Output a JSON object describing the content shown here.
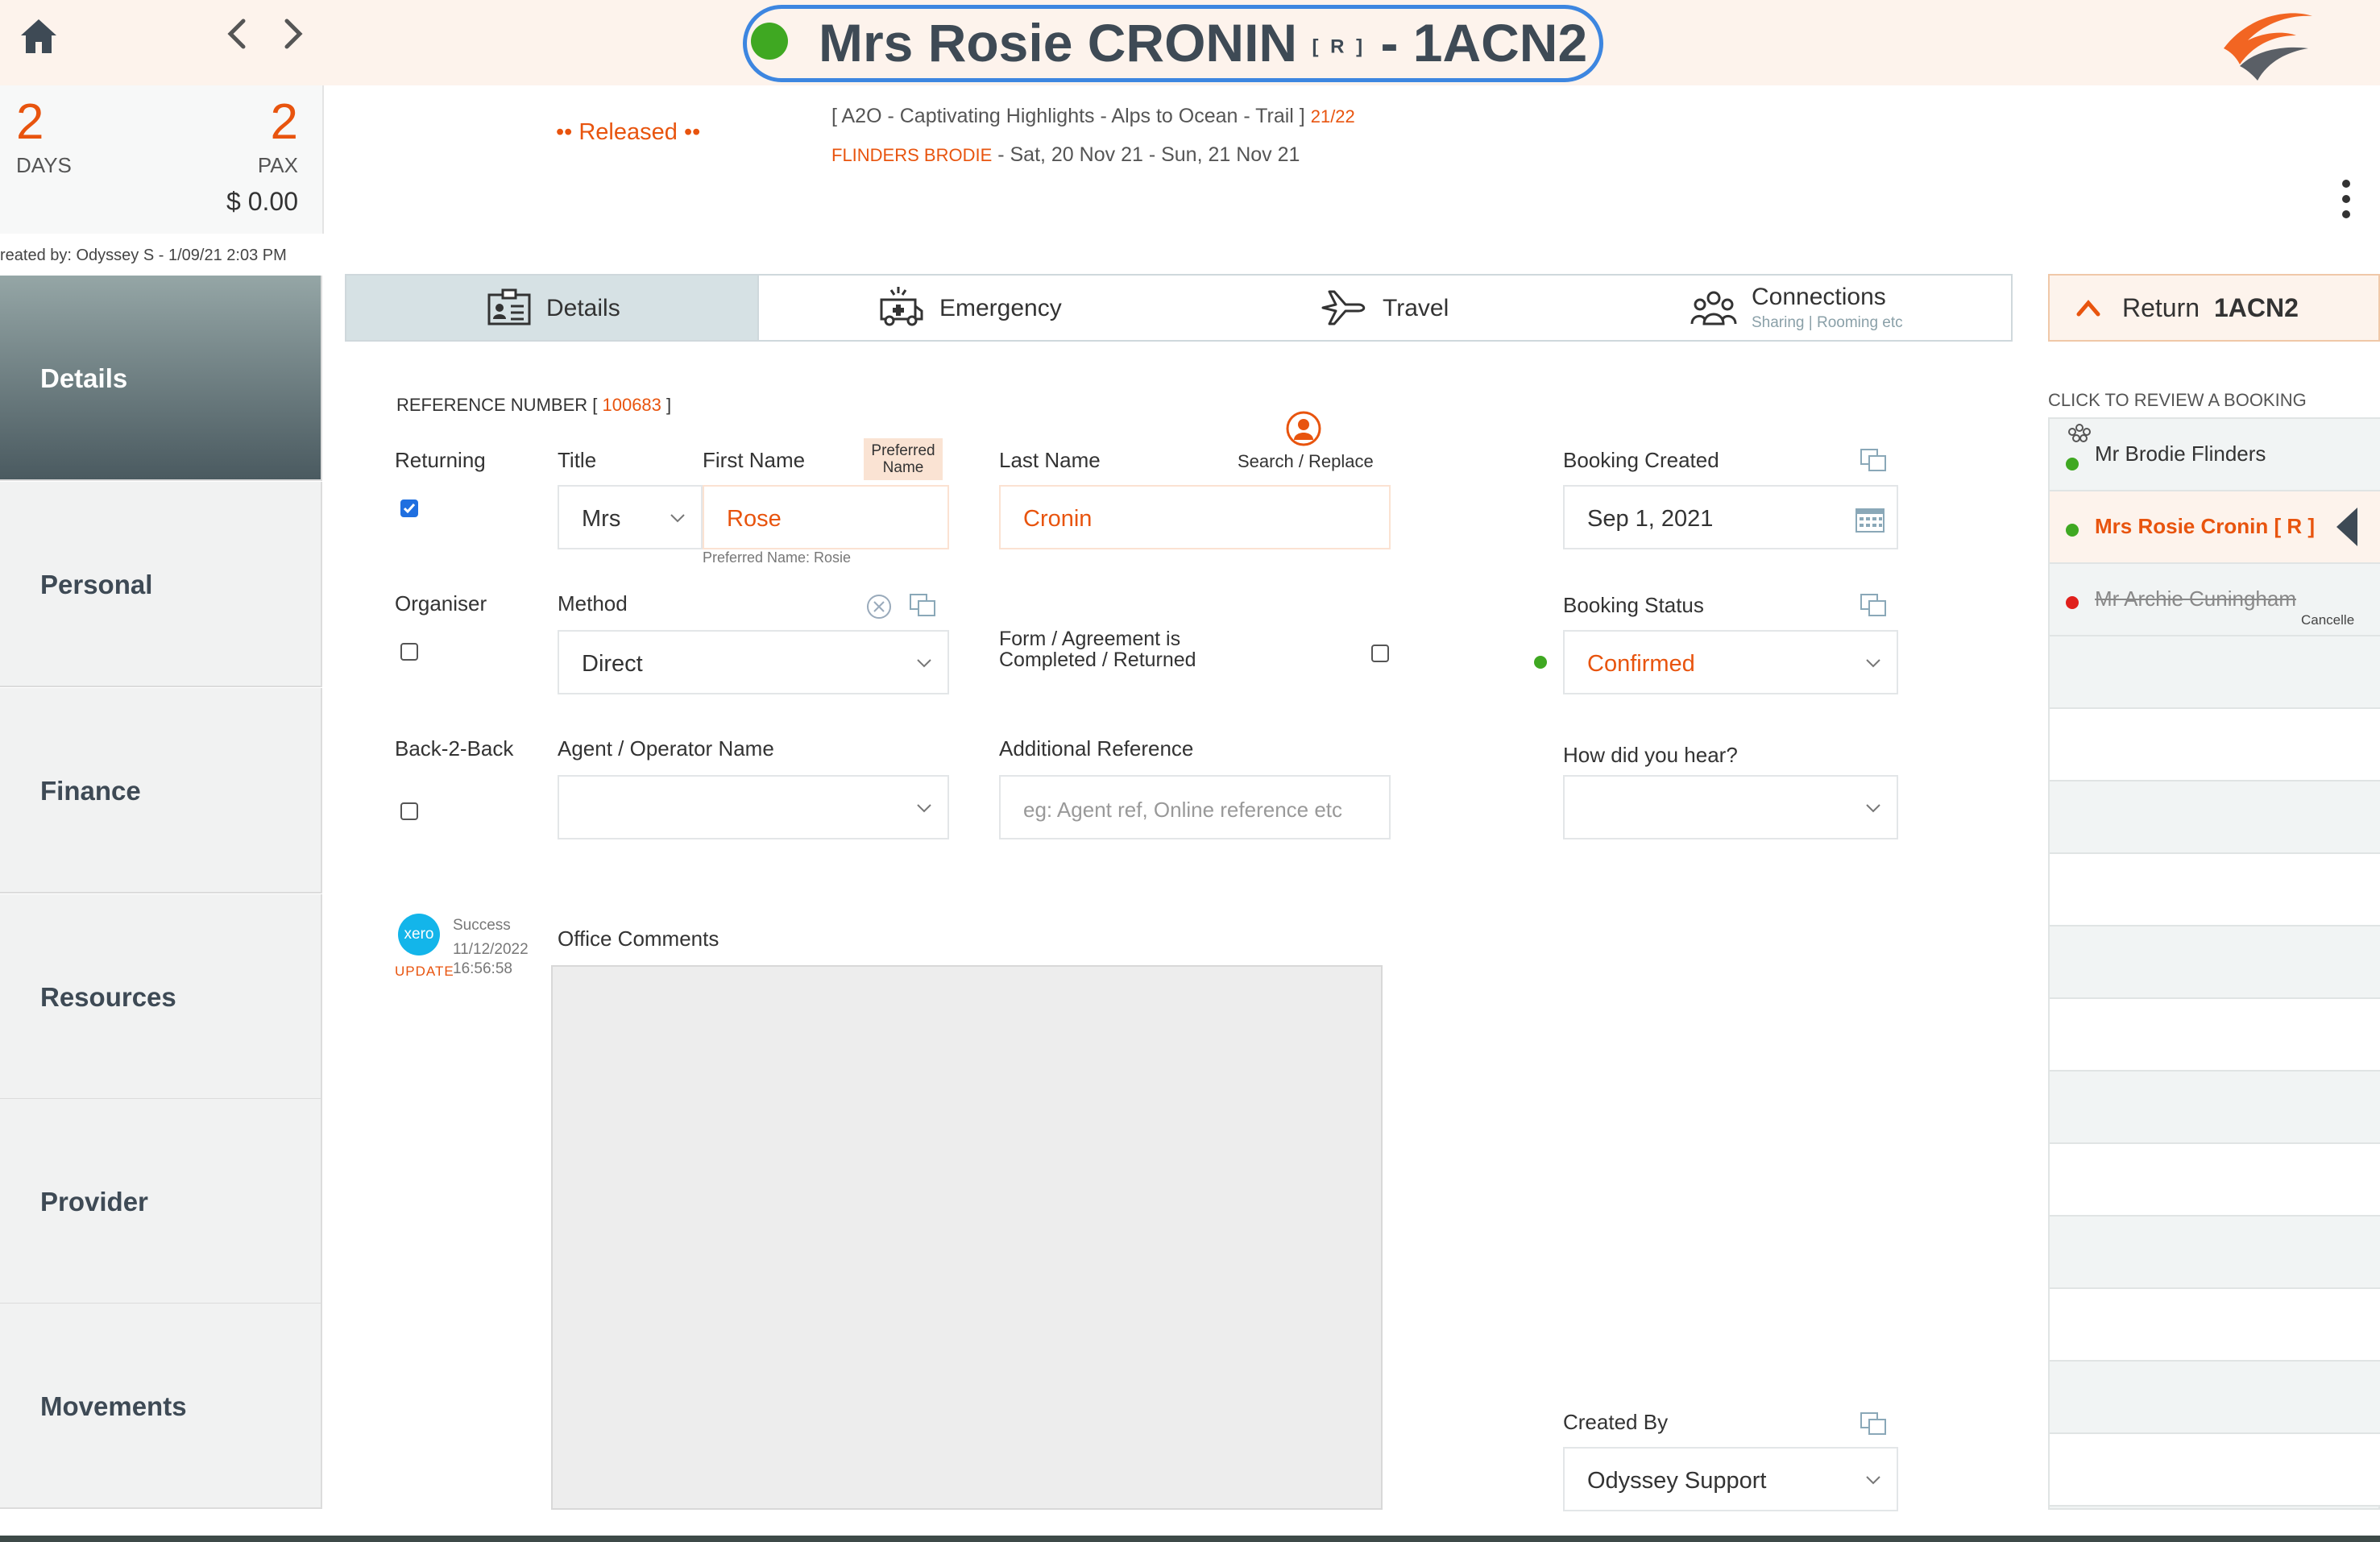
{
  "header": {
    "title_main": "Mrs Rosie CRONIN",
    "title_tag": "[ R ]",
    "title_suffix": "- 1ACN2",
    "status_color": "#3fa822"
  },
  "summary": {
    "days": "2",
    "days_label": "DAYS",
    "pax": "2",
    "pax_label": "PAX",
    "amount": "$ 0.00",
    "created_by": "reated by: Odyssey S - 1/09/21 2:03 PM"
  },
  "booking": {
    "status_text": "•• Released ••",
    "trip_name": "[ A2O - Captivating Highlights - Alps to Ocean - Trail ]",
    "trip_code": "21/22",
    "provider": "FLINDERS BRODIE",
    "dates": "- Sat, 20 Nov 21 - Sun, 21 Nov 21"
  },
  "sidebar": {
    "items": [
      {
        "label": "Details"
      },
      {
        "label": "Personal"
      },
      {
        "label": "Finance"
      },
      {
        "label": "Resources"
      },
      {
        "label": "Provider"
      },
      {
        "label": "Movements"
      }
    ]
  },
  "tabs": {
    "details": "Details",
    "emergency": "Emergency",
    "travel": "Travel",
    "connections": "Connections",
    "connections_sub": "Sharing | Rooming etc"
  },
  "right_panel": {
    "return_label": "Return",
    "return_code": "1ACN2",
    "review_label": "CLICK TO REVIEW A BOOKING",
    "bookings": [
      {
        "name": "Mr Brodie Flinders",
        "status_color": "#3fa822"
      },
      {
        "name": "Mrs Rosie Cronin   [ R ]",
        "status_color": "#3fa822"
      },
      {
        "name": "Mr Archie Cuningham",
        "status_color": "#e0201c",
        "note": "Cancelle"
      }
    ]
  },
  "form": {
    "reference_label": "REFERENCE NUMBER [",
    "reference_number": "100683",
    "reference_close": "]",
    "returning_label": "Returning",
    "returning_checked": true,
    "title_label": "Title",
    "title_value": "Mrs",
    "first_name_label": "First Name",
    "first_name_value": "Rose",
    "preferred_badge": "Preferred Name",
    "preferred_hint": "Preferred Name: Rosie",
    "last_name_label": "Last Name",
    "last_name_value": "Cronin",
    "search_replace": "Search / Replace",
    "booking_created_label": "Booking Created",
    "booking_created_value": "Sep 1, 2021",
    "organiser_label": "Organiser",
    "method_label": "Method",
    "method_value": "Direct",
    "form_agreement_label_1": "Form / Agreement is",
    "form_agreement_label_2": "Completed / Returned",
    "booking_status_label": "Booking Status",
    "booking_status_value": "Confirmed",
    "b2b_label": "Back-2-Back",
    "agent_label": "Agent / Operator Name",
    "agent_value": "",
    "additional_ref_label": "Additional Reference",
    "additional_ref_placeholder": "eg: Agent ref, Online reference etc",
    "hear_label": "How did you hear?",
    "hear_value": "",
    "office_comments_label": "Office Comments",
    "created_by_label": "Created By",
    "created_by_value": "Odyssey Support"
  },
  "xero": {
    "logo_text": "xero",
    "update_label": "UPDATE",
    "status": "Success",
    "date": "11/12/2022",
    "time": "16:56:58"
  },
  "colors": {
    "accent": "#e8540e",
    "link_blue": "#3d86e0",
    "sidebar_active_top": "#95a6a6",
    "sidebar_active_bottom": "#4a5a60"
  }
}
